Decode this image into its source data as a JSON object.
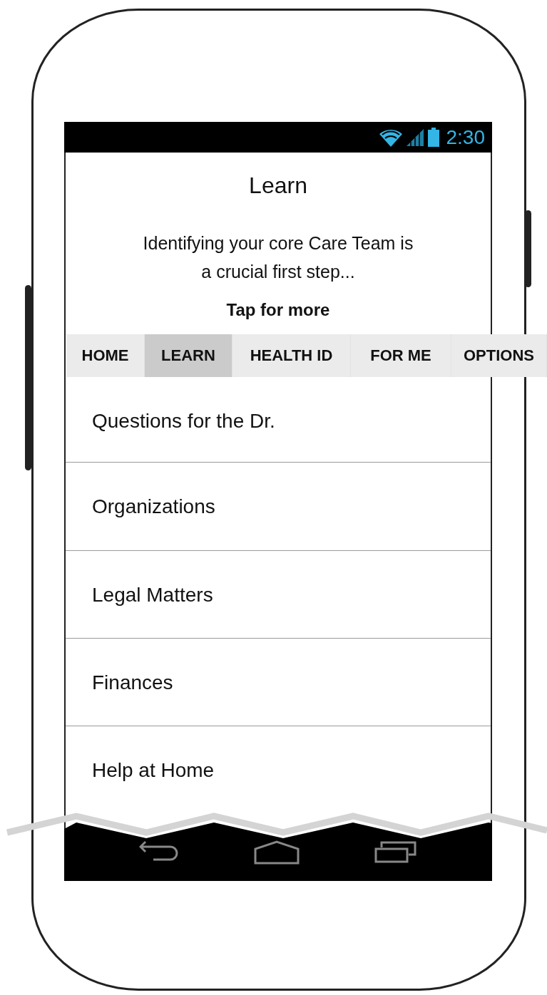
{
  "status_bar": {
    "time": "2:30"
  },
  "header": {
    "title": "Learn",
    "description": "Identifying your core Care Team is a crucial first step...",
    "more_link": "Tap for more"
  },
  "tabs": [
    {
      "label": "HOME",
      "selected": false
    },
    {
      "label": "LEARN",
      "selected": true
    },
    {
      "label": "HEALTH ID",
      "selected": false
    },
    {
      "label": "FOR ME",
      "selected": false
    },
    {
      "label": "OPTIONS",
      "selected": false
    }
  ],
  "menu_items": [
    {
      "label": "Questions for the Dr."
    },
    {
      "label": "Organizations"
    },
    {
      "label": "Legal Matters"
    },
    {
      "label": "Finances"
    },
    {
      "label": "Help at Home"
    }
  ]
}
